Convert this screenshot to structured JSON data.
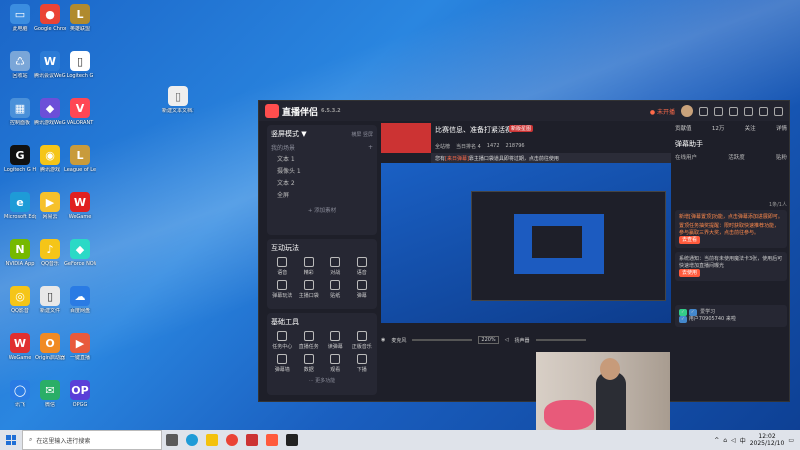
{
  "desktop": {
    "icons": [
      {
        "label": "此电脑",
        "color": "#3b8de0",
        "glyph": "▭"
      },
      {
        "label": "Google Chrome",
        "color": "#ea4335",
        "glyph": "●"
      },
      {
        "label": "英雄联盟",
        "color": "#b08a2e",
        "glyph": "L"
      },
      {
        "label": "回收站",
        "color": "#7aa6d8",
        "glyph": "♺"
      },
      {
        "label": "腾讯会议WeGame",
        "color": "#2b7bd6",
        "glyph": "W"
      },
      {
        "label": "Logitech G",
        "color": "#ffffff",
        "glyph": "▯"
      },
      {
        "label": "控制面板",
        "color": "#4a90d9",
        "glyph": "▦"
      },
      {
        "label": "腾讯游戏WeGame",
        "color": "#6c4fd8",
        "glyph": "◆"
      },
      {
        "label": "VALORANT",
        "color": "#ff4655",
        "glyph": "V"
      },
      {
        "label": "Logitech G HUB",
        "color": "#111111",
        "glyph": "G"
      },
      {
        "label": "腾讯游戏",
        "color": "#f5c518",
        "glyph": "◉"
      },
      {
        "label": "League of Legends",
        "color": "#c89b3c",
        "glyph": "L"
      },
      {
        "label": "Microsoft Edge",
        "color": "#1e9bd7",
        "glyph": "e"
      },
      {
        "label": "网易云",
        "color": "#f6c12b",
        "glyph": "▶"
      },
      {
        "label": "WeGame",
        "color": "#e02020",
        "glyph": "W"
      },
      {
        "label": "NVIDIA App",
        "color": "#76b900",
        "glyph": "N"
      },
      {
        "label": "QQ音乐",
        "color": "#f5c518",
        "glyph": "♪"
      },
      {
        "label": "GeForce NOW",
        "color": "#2bd9c6",
        "glyph": "◆"
      },
      {
        "label": "QQ影音",
        "color": "#f5c518",
        "glyph": "◎"
      },
      {
        "label": "新建文件",
        "color": "#e8e8e8",
        "glyph": "▯"
      },
      {
        "label": "百度网盘",
        "color": "#2a7be4",
        "glyph": "☁"
      },
      {
        "label": "WeGame",
        "color": "#e03030",
        "glyph": "W"
      },
      {
        "label": "Origin启动器",
        "color": "#f08a24",
        "glyph": "O"
      },
      {
        "label": "一键直播",
        "color": "#e85a3c",
        "glyph": "▶"
      },
      {
        "label": "讯飞",
        "color": "#2a7be4",
        "glyph": "◯"
      },
      {
        "label": "微信",
        "color": "#2aae67",
        "glyph": "✉"
      },
      {
        "label": "OPGG",
        "color": "#5a3fd8",
        "glyph": "OP"
      },
      {
        "label": "新建文本文档.txt",
        "color": "#e8e8e8",
        "glyph": "▯"
      }
    ]
  },
  "app": {
    "title": "直播伴侣",
    "version": "6.5.3.2",
    "live_status": "● 未开播",
    "scene_mode": "竖屏模式 ▼",
    "scene_modes": [
      "横屏",
      "竖屏"
    ],
    "my_scenes": "我的场景",
    "scene_items": [
      "文本 1",
      "摄像头 1",
      "文本 2",
      "全屏"
    ],
    "add_source": "+ 添加素材",
    "interactive_title": "互动玩法",
    "interactive_tools": [
      "语音",
      "精彩",
      "对战",
      "语音",
      "弹幕玩法",
      "主播口袋",
      "贴纸",
      "弹幕"
    ],
    "basic_tools_title": "基础工具",
    "basic_tools": [
      "任务中心",
      "直播任务",
      "读弹幕",
      "正版音乐",
      "弹幕墙",
      "数据",
      "观看",
      "下播"
    ],
    "more_features": "··· 更多功能",
    "stream_title": "比赛信息、准备打紧活赛",
    "stream_tag": "新版星图",
    "notice_prefix": "您有",
    "notice_highlight": "[来日弹幕]",
    "notice_text": "靠主播口袋道具即将过期，点击前往使用",
    "mic_label": "麦克风",
    "volume": "220%",
    "speaker_label": "扬声器",
    "stats": [
      "全站榜",
      "当日排名 4",
      "1472",
      "218796"
    ],
    "right_tabs": [
      "贡献值",
      "12万",
      "关注",
      "详情"
    ],
    "chat_title": "弹幕助手",
    "chat_sub_tabs": [
      "在线用户",
      "活跃度",
      "贴粉"
    ],
    "chat_count": "1条/1人",
    "chat_msg1": "新增[弹幕置顶]功能，点击弹幕添加进展即可。",
    "chat_msg2": "置顶任务抽奖提醒：限时获取快速推荐功能，参与赢取三界大奖，点击前往参与。",
    "chat_button": "去查看",
    "system_msg": "系统通知：当前有未使用魔法卡3张，使用后可快速增加直播间曝光",
    "system_button": "去使用",
    "user1": "爱学习",
    "user2": "用户70905740",
    "user2_action": "来啦"
  },
  "taskbar": {
    "search_placeholder": "在这里输入进行搜索",
    "time": "12:02",
    "date": "2025/12/10",
    "lang": "中"
  }
}
